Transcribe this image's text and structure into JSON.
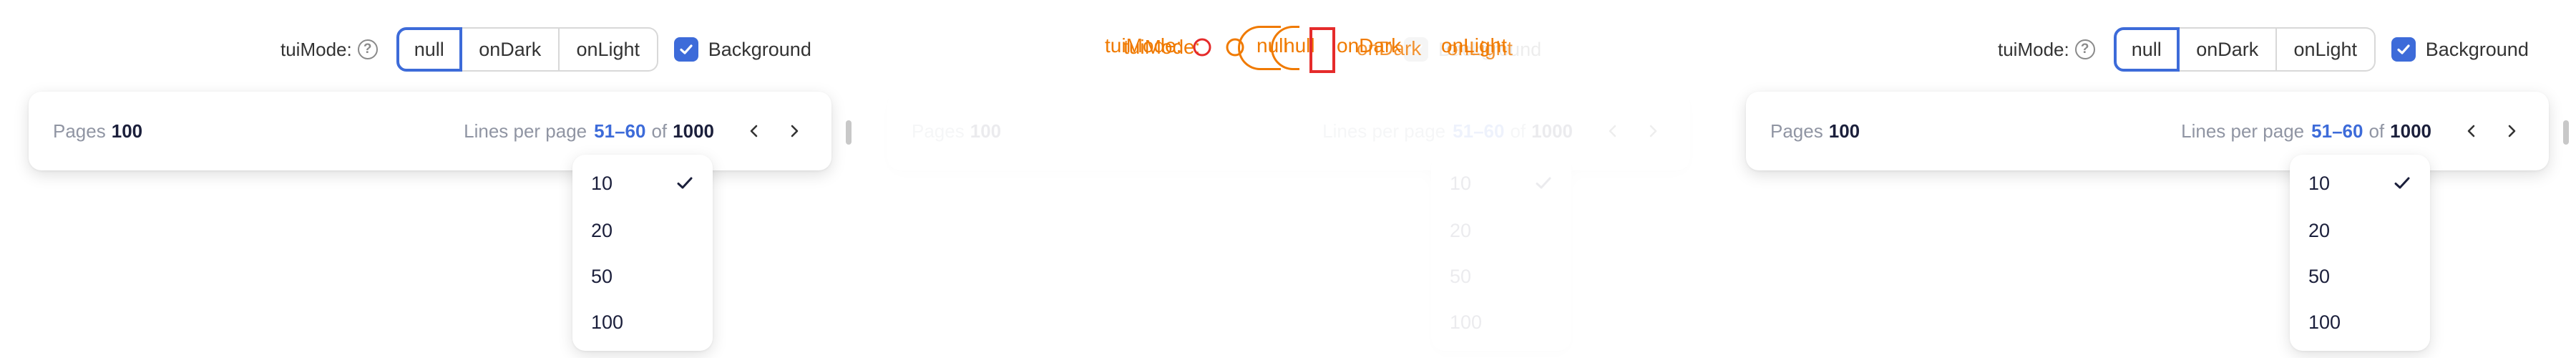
{
  "modebar": {
    "label": "tuiMode:",
    "help_glyph": "?",
    "options": [
      "null",
      "onDark",
      "onLight"
    ],
    "selected": "null",
    "background_checkbox": {
      "label": "Background",
      "checked": true
    }
  },
  "pagination": {
    "pages_label": "Pages",
    "pages_count": "100",
    "lines_label": "Lines per page",
    "range": "51–60",
    "of_label": "of",
    "total": "1000"
  },
  "dropdown": {
    "options": [
      "10",
      "20",
      "50",
      "100"
    ],
    "selected": "10"
  },
  "overlay": {
    "texts": [
      "tuiMode:",
      "tuiMode:",
      "null",
      "null",
      "onDark",
      "onDark",
      "onLight",
      "onLight"
    ]
  },
  "colors": {
    "accent": "#3d6bd9",
    "overlay_orange": "#f07a00",
    "overlay_red": "#e52b2b"
  },
  "icons": {
    "help": "question-circle-icon",
    "check": "checkmark-icon",
    "prev": "chevron-left-icon",
    "next": "chevron-right-icon"
  }
}
